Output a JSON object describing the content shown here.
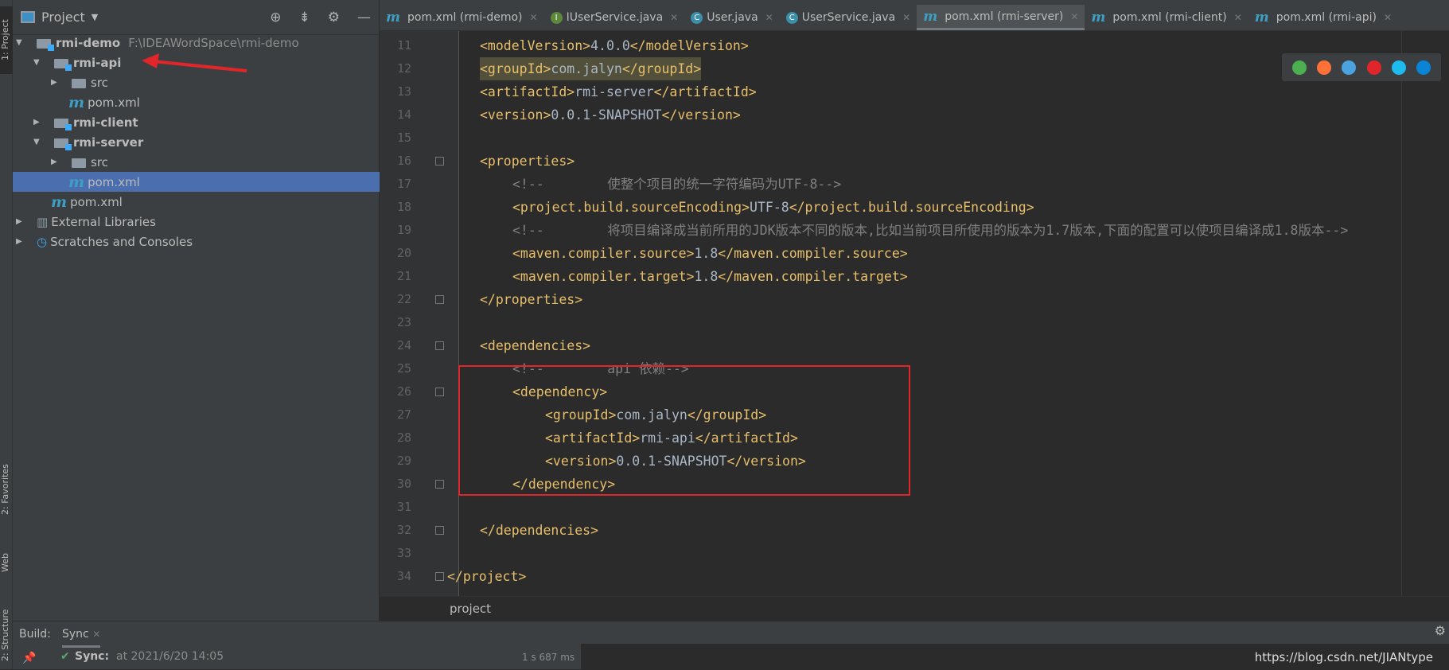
{
  "side_tabs": {
    "project": "1: Project",
    "favorites": "2: Favorites",
    "web": "Web",
    "structure": "2: Structure"
  },
  "panel": {
    "title": "Project",
    "icons": [
      "locate-icon",
      "collapse-icon",
      "gear-icon",
      "minimize-icon"
    ]
  },
  "tree": [
    {
      "label": "rmi-demo",
      "path": "F:\\IDEAWordSpace\\rmi-demo",
      "depth": 0,
      "kind": "module",
      "open": true,
      "bold": true
    },
    {
      "label": "rmi-api",
      "depth": 1,
      "kind": "module",
      "open": true,
      "bold": true
    },
    {
      "label": "src",
      "depth": 2,
      "kind": "folder",
      "open": false
    },
    {
      "label": "pom.xml",
      "depth": 2,
      "kind": "maven"
    },
    {
      "label": "rmi-client",
      "depth": 1,
      "kind": "module",
      "open": false,
      "bold": true
    },
    {
      "label": "rmi-server",
      "depth": 1,
      "kind": "module",
      "open": true,
      "bold": true
    },
    {
      "label": "src",
      "depth": 2,
      "kind": "folder",
      "open": false
    },
    {
      "label": "pom.xml",
      "depth": 2,
      "kind": "maven",
      "selected": true
    },
    {
      "label": "pom.xml",
      "depth": 1,
      "kind": "maven"
    },
    {
      "label": "External Libraries",
      "depth": 0,
      "kind": "libs",
      "open": false
    },
    {
      "label": "Scratches and Consoles",
      "depth": 0,
      "kind": "scratch",
      "open": false
    }
  ],
  "tabs": [
    {
      "label": "pom.xml (rmi-demo)",
      "icon": "maven"
    },
    {
      "label": "IUserService.java",
      "icon": "interface"
    },
    {
      "label": "User.java",
      "icon": "class"
    },
    {
      "label": "UserService.java",
      "icon": "class"
    },
    {
      "label": "pom.xml (rmi-server)",
      "icon": "maven",
      "active": true
    },
    {
      "label": "pom.xml (rmi-client)",
      "icon": "maven"
    },
    {
      "label": "pom.xml (rmi-api)",
      "icon": "maven"
    }
  ],
  "code": [
    {
      "n": "11",
      "indent": 1,
      "text": "<modelVersion>4.0.0</modelVersion>"
    },
    {
      "n": "12",
      "indent": 1,
      "text": "<groupId>com.jalyn</groupId>",
      "highlight": true
    },
    {
      "n": "13",
      "indent": 1,
      "text": "<artifactId>rmi-server</artifactId>"
    },
    {
      "n": "14",
      "indent": 1,
      "text": "<version>0.0.1-SNAPSHOT</version>"
    },
    {
      "n": "15",
      "indent": 0,
      "text": ""
    },
    {
      "n": "16",
      "indent": 1,
      "text": "<properties>",
      "fold": true
    },
    {
      "n": "17",
      "indent": 2,
      "text": "<!--        使整个项目的统一字符编码为UTF-8-->",
      "comment": true
    },
    {
      "n": "18",
      "indent": 2,
      "text": "<project.build.sourceEncoding>UTF-8</project.build.sourceEncoding>"
    },
    {
      "n": "19",
      "indent": 2,
      "text": "<!--        将项目编译成当前所用的JDK版本不同的版本,比如当前项目所使用的版本为1.7版本,下面的配置可以使项目编译成1.8版本-->",
      "comment": true
    },
    {
      "n": "20",
      "indent": 2,
      "text": "<maven.compiler.source>1.8</maven.compiler.source>"
    },
    {
      "n": "21",
      "indent": 2,
      "text": "<maven.compiler.target>1.8</maven.compiler.target>"
    },
    {
      "n": "22",
      "indent": 1,
      "text": "</properties>",
      "fold": true
    },
    {
      "n": "23",
      "indent": 0,
      "text": ""
    },
    {
      "n": "24",
      "indent": 1,
      "text": "<dependencies>",
      "fold": true
    },
    {
      "n": "25",
      "indent": 2,
      "text": "<!--        api 依赖-->",
      "comment": true
    },
    {
      "n": "26",
      "indent": 2,
      "text": "<dependency>",
      "fold": true
    },
    {
      "n": "27",
      "indent": 3,
      "text": "<groupId>com.jalyn</groupId>"
    },
    {
      "n": "28",
      "indent": 3,
      "text": "<artifactId>rmi-api</artifactId>"
    },
    {
      "n": "29",
      "indent": 3,
      "text": "<version>0.0.1-SNAPSHOT</version>"
    },
    {
      "n": "30",
      "indent": 2,
      "text": "</dependency>",
      "fold": true
    },
    {
      "n": "31",
      "indent": 0,
      "text": ""
    },
    {
      "n": "32",
      "indent": 1,
      "text": "</dependencies>",
      "fold": true
    },
    {
      "n": "33",
      "indent": 0,
      "text": ""
    },
    {
      "n": "34",
      "indent": 0,
      "text": "</project>",
      "fold": true
    }
  ],
  "breadcrumb": "project",
  "browsers": [
    {
      "name": "chrome-icon",
      "color": "#4caf50"
    },
    {
      "name": "firefox-icon",
      "color": "#ff7139"
    },
    {
      "name": "safari-icon",
      "color": "#4aa3df"
    },
    {
      "name": "opera-icon",
      "color": "#e0262a"
    },
    {
      "name": "ie-icon",
      "color": "#1ebbee"
    },
    {
      "name": "edge-icon",
      "color": "#0a84d6"
    }
  ],
  "build": {
    "label": "Build:",
    "tab": "Sync",
    "status_title": "Sync:",
    "status_time": "at 2021/6/20 14:05",
    "duration": "1 s 687 ms"
  },
  "watermark": "https://blog.csdn.net/JIANtype",
  "colors": {
    "tag": "#e8bf6a",
    "text": "#a9b7c6",
    "comment": "#808080",
    "selection": "#4b6eaf",
    "annotation": "#e0262a"
  }
}
